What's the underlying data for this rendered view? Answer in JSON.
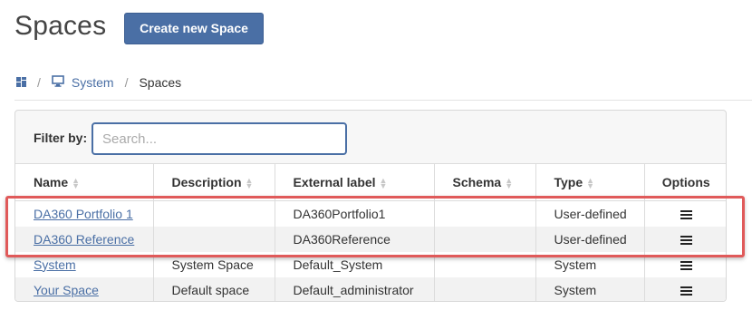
{
  "page": {
    "title": "Spaces",
    "create_button": "Create new Space"
  },
  "breadcrumb": {
    "home_icon": "grid-home-icon",
    "separator": "/",
    "system_icon": "monitor-icon",
    "system": "System",
    "current": "Spaces"
  },
  "filter": {
    "label": "Filter by:",
    "placeholder": "Search...",
    "value": ""
  },
  "table": {
    "headers": {
      "name": "Name",
      "description": "Description",
      "external_label": "External label",
      "schema": "Schema",
      "type": "Type",
      "options": "Options"
    },
    "rows": [
      {
        "name": "DA360 Portfolio 1",
        "description": "",
        "external_label": "DA360Portfolio1",
        "schema": "",
        "type": "User-defined"
      },
      {
        "name": "DA360 Reference",
        "description": "",
        "external_label": "DA360Reference",
        "schema": "",
        "type": "User-defined"
      },
      {
        "name": "System",
        "description": "System Space",
        "external_label": "Default_System",
        "schema": "",
        "type": "System"
      },
      {
        "name": "Your Space",
        "description": "Default space",
        "external_label": "Default_administrator",
        "schema": "",
        "type": "System"
      }
    ]
  },
  "colors": {
    "accent": "#4a6fa5",
    "highlight": "#e05a5a"
  }
}
